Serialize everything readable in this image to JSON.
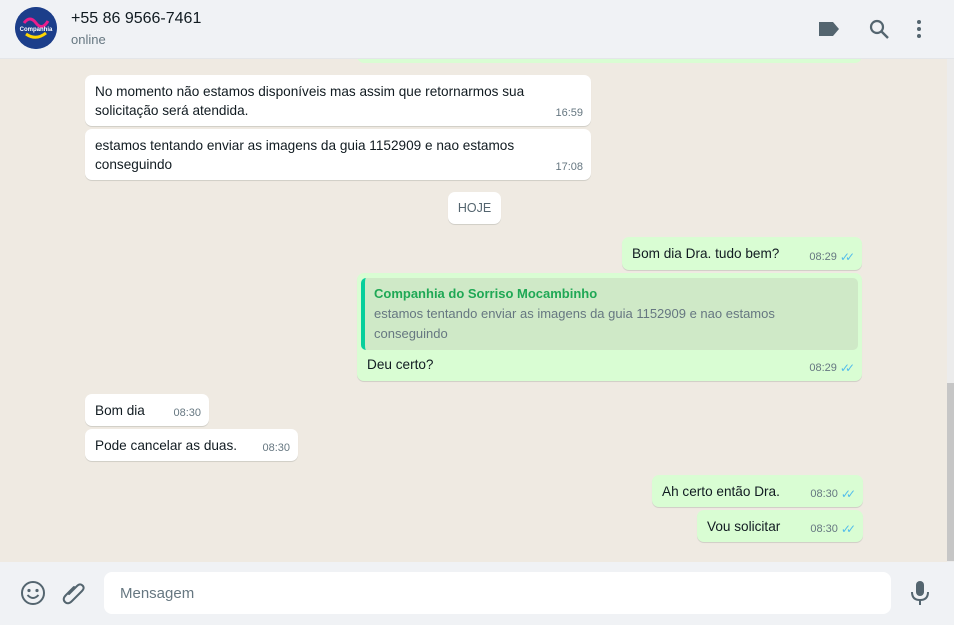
{
  "header": {
    "avatar_text": "Companhia do Sorriso",
    "contact_name": "+55 86 9566-7461",
    "status": "online",
    "icons": [
      "label-icon",
      "search-icon",
      "menu-icon"
    ]
  },
  "date_divider": "HOJE",
  "messages": [
    {
      "dir": "in",
      "text": "No momento não estamos disponíveis mas assim que retornarmos sua solicitação será atendida.",
      "time": "16:59"
    },
    {
      "dir": "in",
      "text": "estamos tentando enviar as imagens da guia 1152909 e nao estamos conseguindo",
      "time": "17:08"
    },
    {
      "dir": "out",
      "text": "Bom dia Dra. tudo bem?",
      "time": "08:29",
      "status": "read"
    },
    {
      "dir": "out",
      "quote_author": "Companhia do Sorriso Mocambinho",
      "quote_text": "estamos tentando enviar as imagens da guia 1152909 e nao estamos conseguindo",
      "text": "Deu certo?",
      "time": "08:29",
      "status": "read"
    },
    {
      "dir": "in",
      "text": "Bom dia",
      "time": "08:30"
    },
    {
      "dir": "in",
      "text": "Pode cancelar as duas.",
      "time": "08:30"
    },
    {
      "dir": "out",
      "text": "Ah certo então Dra.",
      "time": "08:30",
      "status": "read"
    },
    {
      "dir": "out",
      "text": "Vou solicitar",
      "time": "08:30",
      "status": "read"
    }
  ],
  "footer": {
    "input_placeholder": "Mensagem",
    "input_value": "",
    "icons": [
      "emoji-icon",
      "attach-icon",
      "microphone-icon"
    ]
  },
  "colors": {
    "incoming": "#ffffff",
    "outgoing": "#d9fdd3",
    "background": "#efeae2",
    "read_ticks": "#53bdeb",
    "quote_author": "#1fa855"
  }
}
